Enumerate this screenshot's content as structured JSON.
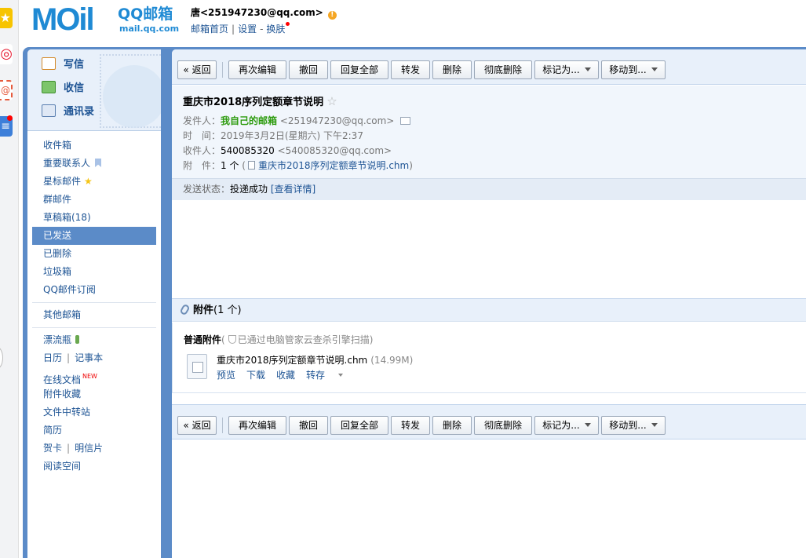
{
  "header": {
    "logo_letters": "MOil",
    "logo_cn": "QQ邮箱",
    "logo_url": "mail.qq.com",
    "account": "唐<251947230@qq.com>",
    "links": [
      "邮箱首页",
      "设置",
      "换肤"
    ],
    "warn_icon": "warning-icon"
  },
  "sidebar": {
    "quick": [
      {
        "label": "写信",
        "icon": "write-icon"
      },
      {
        "label": "收信",
        "icon": "inbox-icon"
      },
      {
        "label": "通讯录",
        "icon": "contacts-icon"
      }
    ],
    "folders": [
      {
        "label": "收件箱"
      },
      {
        "label": "重要联系人"
      },
      {
        "label": "星标邮件"
      },
      {
        "label": "群邮件"
      },
      {
        "label": "草稿箱(18)"
      },
      {
        "label": "已发送",
        "active": true
      },
      {
        "label": "已删除"
      },
      {
        "label": "垃圾箱"
      },
      {
        "label": "QQ邮件订阅"
      }
    ],
    "other": "其他邮箱",
    "apps": {
      "drift": "漂流瓶",
      "calendar": "日历",
      "notes": "记事本",
      "docs": "在线文档",
      "new_badge": "NEW",
      "attach_fav": "附件收藏",
      "transfer": "文件中转站",
      "resume": "简历",
      "card": "贺卡",
      "postcard": "明信片",
      "reading": "阅读空间"
    }
  },
  "toolbar": {
    "back": "« 返回",
    "reedit": "再次编辑",
    "recall": "撤回",
    "reply_all": "回复全部",
    "forward": "转发",
    "delete": "删除",
    "delete_forever": "彻底删除",
    "mark_as": "标记为...",
    "move_to": "移动到..."
  },
  "mail": {
    "subject": "重庆市2018序列定额章节说明",
    "star": "☆",
    "from_label": "发件人：",
    "from_name": "我自己的邮箱",
    "from_addr": "<251947230@qq.com>",
    "time_label": "时　间：",
    "time_value": "2019年3月2日(星期六) 下午2:37",
    "to_label": "收件人：",
    "to_name": "540085320",
    "to_addr": "<540085320@qq.com>",
    "att_label": "附　件：",
    "att_count": "1 个",
    "att_open": "(",
    "att_file": "重庆市2018序列定额章节说明.chm",
    "att_close": ")",
    "status_label": "发送状态：",
    "status_value": "投递成功",
    "status_link": "[查看详情]"
  },
  "attachment": {
    "title": "附件",
    "count": "(1 个)",
    "kind": "普通附件",
    "scan_open": "(",
    "scan": "已通过电脑管家云查杀引擎扫描",
    "scan_close": ")",
    "file_name": "重庆市2018序列定额章节说明.chm",
    "file_size": "(14.99M)",
    "actions": [
      "预览",
      "下载",
      "收藏",
      "转存"
    ]
  },
  "colors": {
    "brand": "#1f8ad4",
    "frame": "#5b8bc8",
    "link": "#1e5494",
    "sender_green": "#2d9b0e"
  }
}
